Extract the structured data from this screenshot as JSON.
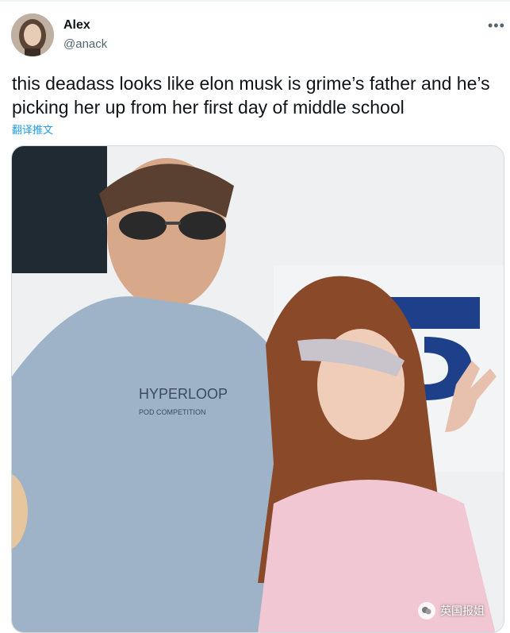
{
  "tweet": {
    "author_name": "Alex",
    "author_handle": "@anack",
    "more_icon": "more-horizontal-icon",
    "text": "this deadass looks like elon musk is grime’s father and he’s picking her up from her first day of middle school",
    "translate_label": "翻译推文"
  },
  "media": {
    "shirt_brand": "HYPERLOOP",
    "shirt_sub": "POD COMPETITION",
    "watermark": "英国报姐"
  },
  "colors": {
    "link": "#1d9bf0",
    "secondary_text": "#536471",
    "border": "#cfd9de"
  }
}
